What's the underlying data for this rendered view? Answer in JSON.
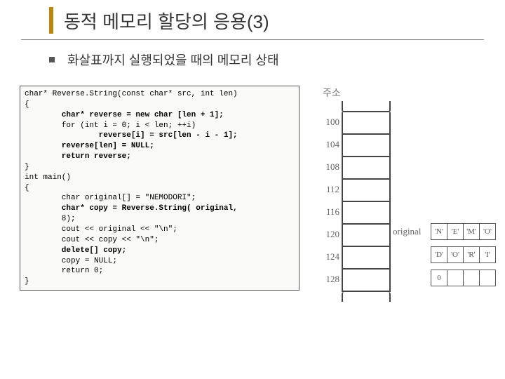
{
  "title": "동적 메모리 할당의 응용(3)",
  "bullet": "화살표까지 실행되었을 때의 메모리 상태",
  "code": {
    "l1": "char* Reverse.String(const char* src, int len)",
    "l2": "{",
    "l3": "        char* reverse = new char [len + 1];",
    "l4": "",
    "l5": "        for (int i = 0; i < len; ++i)",
    "l6": "                reverse[i] = src[len - i - 1];",
    "l7": "",
    "l8": "        reverse[len] = NULL;",
    "l9": "        return reverse;",
    "l10": "}",
    "l11": "",
    "l12": "int main()",
    "l13": "{",
    "l14": "        char original[] = \"NEMODORI\";",
    "l15": "        char* copy = Reverse.String( original,",
    "l16": "        8);",
    "l17": "",
    "l18": "        cout << original << \"\\n\";",
    "l19": "        cout << copy << \"\\n\";",
    "l20": "",
    "l21": "        delete[] copy;",
    "l22": "        copy = NULL;",
    "l23": "        return 0;",
    "l24": "}"
  },
  "mem": {
    "header": "주소",
    "addrs": [
      "100",
      "104",
      "108",
      "112",
      "116",
      "120",
      "124",
      "128"
    ],
    "label120": "original",
    "row1": [
      "'N'",
      "'E'",
      "'M'",
      "'O'"
    ],
    "row2": [
      "'D'",
      "'O'",
      "'R'",
      "'I'"
    ],
    "row3": [
      "0",
      "",
      "",
      ""
    ]
  }
}
